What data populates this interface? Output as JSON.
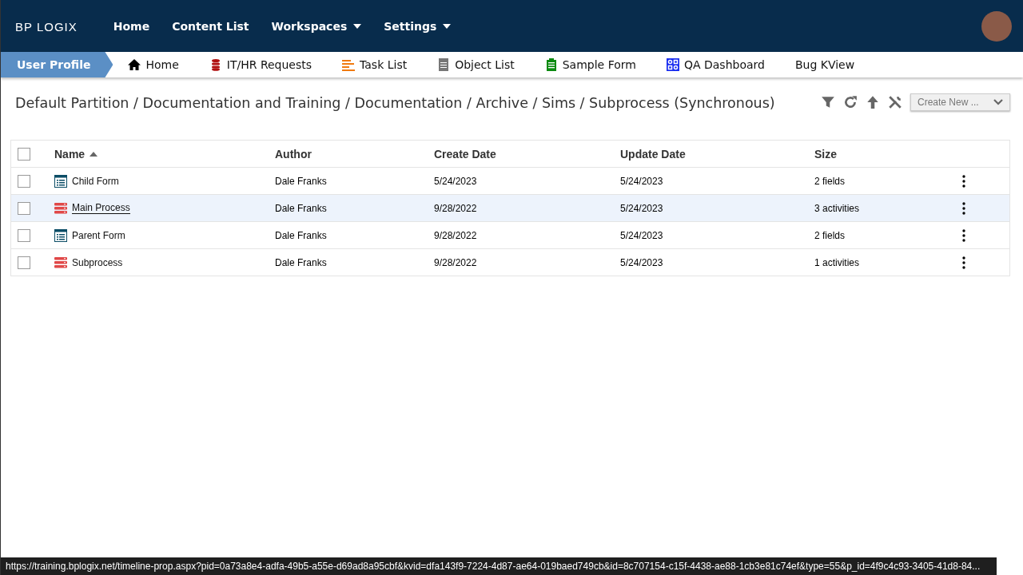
{
  "header": {
    "logo": "BP LOGIX",
    "menu": [
      {
        "label": "Home",
        "dropdown": false
      },
      {
        "label": "Content List",
        "dropdown": false
      },
      {
        "label": "Workspaces",
        "dropdown": true
      },
      {
        "label": "Settings",
        "dropdown": true
      }
    ]
  },
  "tabs": [
    {
      "label": "User Profile",
      "selected": true,
      "kind": "none"
    },
    {
      "label": "Home",
      "selected": false,
      "kind": "home"
    },
    {
      "label": "IT/HR Requests",
      "selected": false,
      "kind": "database"
    },
    {
      "label": "Task List",
      "selected": false,
      "kind": "lines"
    },
    {
      "label": "Object List",
      "selected": false,
      "kind": "document"
    },
    {
      "label": "Sample Form",
      "selected": false,
      "kind": "clipboard"
    },
    {
      "label": "QA Dashboard",
      "selected": false,
      "kind": "dashboard"
    },
    {
      "label": "Bug KView",
      "selected": false,
      "kind": "none"
    }
  ],
  "breadcrumb": "Default Partition / Documentation and Training / Documentation / Archive / Sims / Subprocess (Synchronous)",
  "create_button": "Create New ...",
  "table": {
    "all_checked": false,
    "columns": [
      {
        "label": "Name",
        "sorted": true
      },
      {
        "label": "Author",
        "sorted": false
      },
      {
        "label": "Create Date",
        "sorted": false
      },
      {
        "label": "Update Date",
        "sorted": false
      },
      {
        "label": "Size",
        "sorted": false
      }
    ],
    "rows": [
      {
        "kind": "form",
        "name": "Child Form",
        "author": "Dale Franks",
        "create_date": "5/24/2023",
        "update_date": "5/24/2023",
        "size": "2 fields",
        "selected": false,
        "checked": false
      },
      {
        "kind": "process",
        "name": "Main Process",
        "author": "Dale Franks",
        "create_date": "9/28/2022",
        "update_date": "5/24/2023",
        "size": "3 activities",
        "selected": true,
        "checked": false
      },
      {
        "kind": "form",
        "name": "Parent Form",
        "author": "Dale Franks",
        "create_date": "9/28/2022",
        "update_date": "5/24/2023",
        "size": "2 fields",
        "selected": false,
        "checked": false
      },
      {
        "kind": "process",
        "name": "Subprocess",
        "author": "Dale Franks",
        "create_date": "9/28/2022",
        "update_date": "5/24/2023",
        "size": "1 activities",
        "selected": false,
        "checked": false
      }
    ]
  },
  "status_bar": "https://training.bplogix.net/timeline-prop.aspx?pid=0a73a8e4-adfa-49b5-a55e-d69ad8a95cbf&kvid=dfa143f9-7224-4d87-ae64-019baed749cb&id=8c707154-c15f-4438-ae88-1cb3e81c74ef&type=55&p_id=4f9c4c93-3405-41d8-84..."
}
